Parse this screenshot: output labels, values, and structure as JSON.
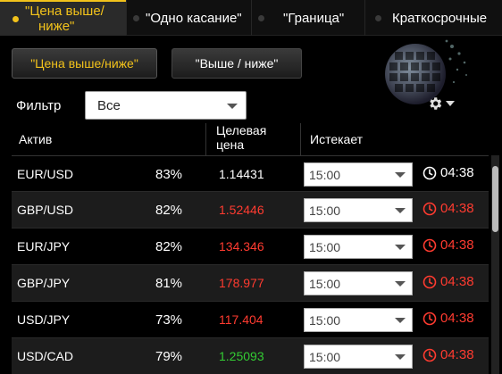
{
  "tabs": [
    {
      "label_line1": "\"Цена выше/",
      "label_line2": "ниже\"",
      "active": true
    },
    {
      "label": "\"Одно касание\"",
      "active": false
    },
    {
      "label": "\"Граница\"",
      "active": false
    },
    {
      "label": "Краткосрочные",
      "active": false
    }
  ],
  "subtabs": {
    "highlow": "\"Цена выше/ниже\"",
    "updown": "\"Выше / ниже\""
  },
  "filter": {
    "label": "Фильтр",
    "value": "Все"
  },
  "table": {
    "headers": {
      "asset": "Актив",
      "target_line1": "Целевая",
      "target_line2": "цена",
      "expires": "Истекает"
    },
    "rows": [
      {
        "symbol": "EUR/USD",
        "payout": "83%",
        "price": "1.14431",
        "price_color": "#ffffff",
        "expiry": "15:00",
        "timer": "04:38",
        "timer_color": "#ffffff"
      },
      {
        "symbol": "GBP/USD",
        "payout": "82%",
        "price": "1.52446",
        "price_color": "#ff3b30",
        "expiry": "15:00",
        "timer": "04:38",
        "timer_color": "#ff3b30"
      },
      {
        "symbol": "EUR/JPY",
        "payout": "82%",
        "price": "134.346",
        "price_color": "#ff3b30",
        "expiry": "15:00",
        "timer": "04:38",
        "timer_color": "#ff3b30"
      },
      {
        "symbol": "GBP/JPY",
        "payout": "81%",
        "price": "178.977",
        "price_color": "#ff3b30",
        "expiry": "15:00",
        "timer": "04:38",
        "timer_color": "#ff3b30"
      },
      {
        "symbol": "USD/JPY",
        "payout": "73%",
        "price": "117.404",
        "price_color": "#ff3b30",
        "expiry": "15:00",
        "timer": "04:38",
        "timer_color": "#ff3b30"
      },
      {
        "symbol": "USD/CAD",
        "payout": "79%",
        "price": "1.25093",
        "price_color": "#33cc33",
        "expiry": "15:00",
        "timer": "04:38",
        "timer_color": "#ff3b30"
      }
    ]
  },
  "icons": {
    "settings": "gear-icon",
    "timer": "clock-icon",
    "dropdown": "chevron-down-icon",
    "brand": "globe-icon"
  },
  "colors": {
    "accent": "#f2c21b",
    "down": "#ff3b30",
    "up": "#33cc33"
  }
}
